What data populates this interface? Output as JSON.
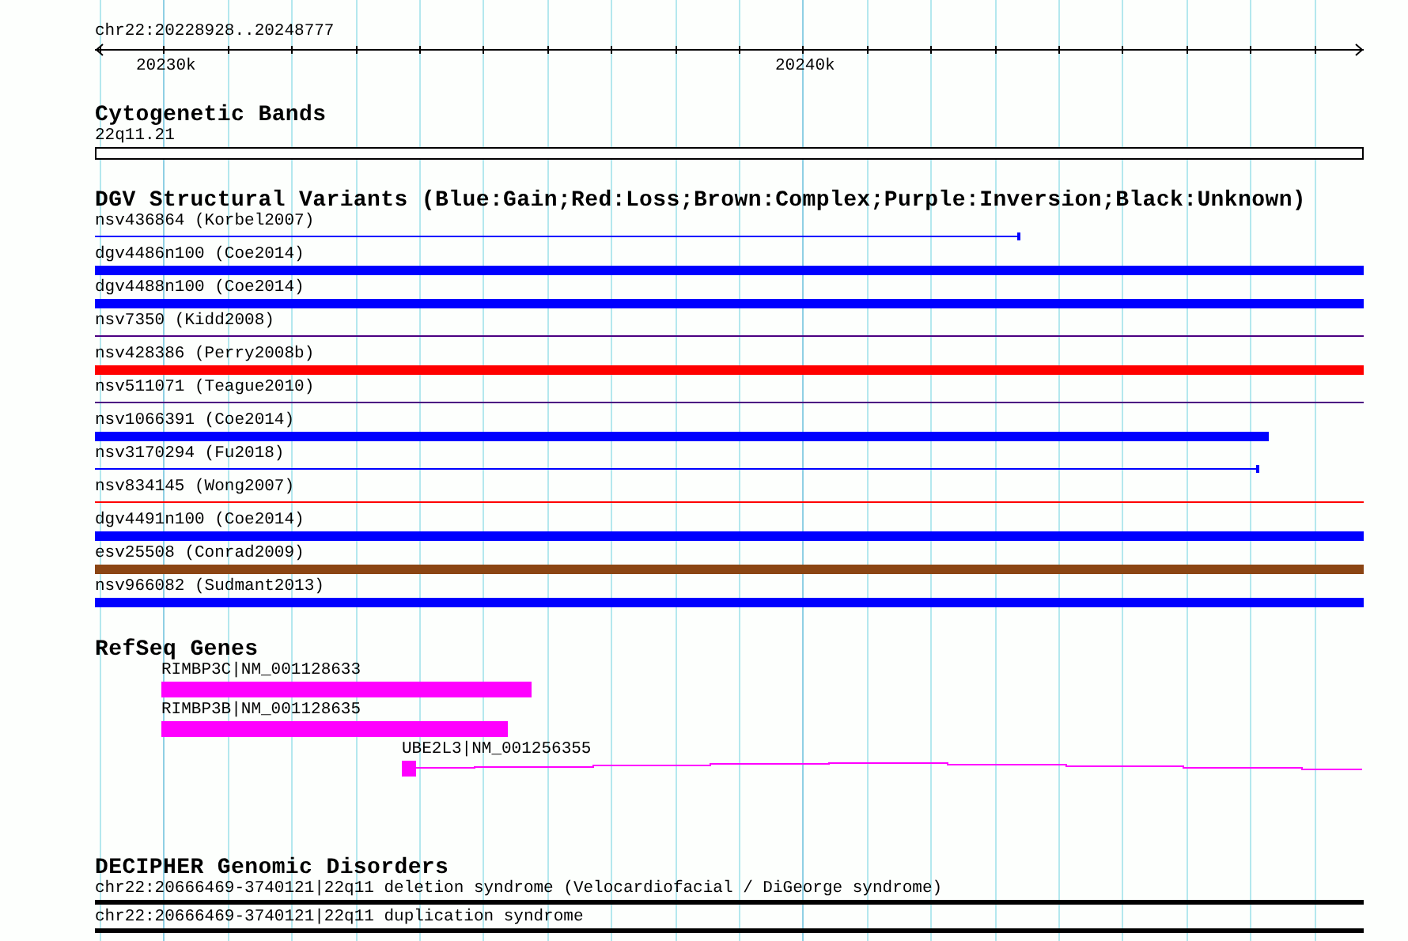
{
  "ruler": {
    "region": "chr22:20228928..20248777",
    "tick_labels": [
      "20230k",
      "20240k"
    ]
  },
  "tracks": [
    {
      "kind": "cytoband",
      "title": "Cytogenetic Bands",
      "features": [
        {
          "label": "22q11.21"
        }
      ]
    },
    {
      "kind": "variants",
      "title": "DGV Structural Variants (Blue:Gain;Red:Loss;Brown:Complex;Purple:Inversion;Black:Unknown)",
      "features": [
        {
          "label": "nsv436864 (Korbel2007)",
          "kind": "thin",
          "color": "#0000ff"
        },
        {
          "label": "dgv4486n100 (Coe2014)",
          "kind": "thick",
          "color": "#0000ff"
        },
        {
          "label": "dgv4488n100 (Coe2014)",
          "kind": "thick",
          "color": "#0000ff"
        },
        {
          "label": "nsv7350 (Kidd2008)",
          "kind": "thin",
          "color": "#4b0082"
        },
        {
          "label": "nsv428386 (Perry2008b)",
          "kind": "thick",
          "color": "#ff0000"
        },
        {
          "label": "nsv511071 (Teague2010)",
          "kind": "thin",
          "color": "#4b0082"
        },
        {
          "label": "nsv1066391 (Coe2014)",
          "kind": "thick",
          "color": "#0000ff"
        },
        {
          "label": "nsv3170294 (Fu2018)",
          "kind": "thin",
          "color": "#0000ff"
        },
        {
          "label": "nsv834145 (Wong2007)",
          "kind": "thin",
          "color": "#ff0000"
        },
        {
          "label": "dgv4491n100 (Coe2014)",
          "kind": "thick",
          "color": "#0000ff"
        },
        {
          "label": "esv25508 (Conrad2009)",
          "kind": "thick",
          "color": "#8b4513"
        },
        {
          "label": "nsv966082 (Sudmant2013)",
          "kind": "thick",
          "color": "#0000ff"
        }
      ]
    },
    {
      "kind": "genes",
      "title": "RefSeq Genes",
      "features": [
        {
          "label": "RIMBP3C|NM_001128633",
          "kind": "block"
        },
        {
          "label": "RIMBP3B|NM_001128635",
          "kind": "block"
        },
        {
          "label": "UBE2L3|NM_001256355",
          "kind": "transcript"
        }
      ]
    },
    {
      "kind": "disorders",
      "title": "DECIPHER Genomic Disorders",
      "features": [
        {
          "label": "chr22:20666469-3740121|22q11 deletion syndrome (Velocardiofacial / DiGeorge syndrome)"
        },
        {
          "label": "chr22:20666469-3740121|22q11 duplication syndrome"
        }
      ]
    }
  ]
}
